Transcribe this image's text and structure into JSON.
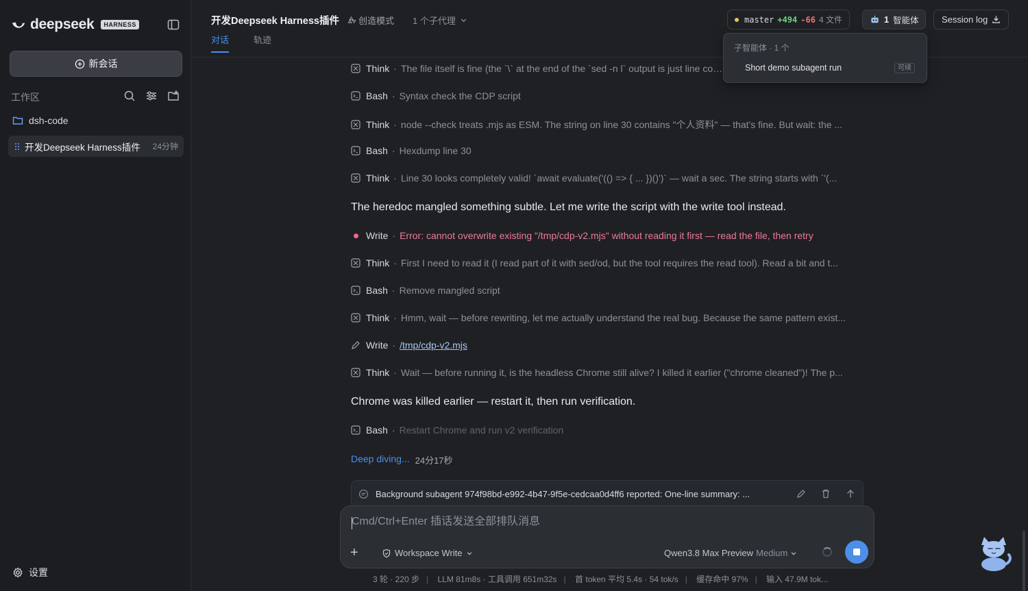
{
  "sidebar": {
    "brand_name": "deepseek",
    "brand_badge": "HARNESS",
    "new_chat_label": "新会话",
    "workspace_label": "工作区",
    "folder_name": "dsh-code",
    "session": {
      "title": "开发Deepseek Harness插件",
      "time": "24分钟"
    },
    "settings_label": "设置"
  },
  "header": {
    "title": "开发Deepseek Harness插件",
    "mode_label": "创造模式",
    "agents_dropdown": "1 个子代理",
    "tabs": [
      {
        "label": "对话"
      },
      {
        "label": "轨迹"
      }
    ],
    "branch": {
      "name": "master",
      "added": "+494",
      "removed": "-66",
      "files": "4 文件"
    },
    "agent_count": "1",
    "agent_label": "智能体",
    "session_log_label": "Session log"
  },
  "popover": {
    "heading": "子智能体 · 1 个",
    "item": "Short demo subagent run",
    "badge": "可续"
  },
  "messages": [
    {
      "kind": "Think",
      "icon": "think-icon",
      "text": "The file itself is fine (the `\\` at the end of the `sed -n l` output is just line continuation)..."
    },
    {
      "kind": "Bash",
      "icon": "terminal-icon",
      "text": "Syntax check the CDP script"
    },
    {
      "kind": "Think",
      "icon": "think-icon",
      "text": "node --check treats .mjs as ESM. The string on line 30 contains \"个人资料\" — that's fine. But wait: the ..."
    },
    {
      "kind": "Bash",
      "icon": "terminal-icon",
      "text": "Hexdump line 30"
    },
    {
      "kind": "Think",
      "icon": "think-icon",
      "text": "Line 30 looks completely valid! `await evaluate('(() => { ... })()')` — wait a sec. The string starts with `'(..."
    },
    {
      "kind": "Write",
      "icon": "error-dot-icon",
      "text": "Error: cannot overwrite existing \"/tmp/cdp-v2.mjs\" without reading it first — read the file, then retry"
    },
    {
      "kind": "Think",
      "icon": "think-icon",
      "text": "First I need to read it (I read part of it with sed/od, but the tool requires the read tool). Read a bit and t..."
    },
    {
      "kind": "Bash",
      "icon": "terminal-icon",
      "text": "Remove mangled script"
    },
    {
      "kind": "Think",
      "icon": "think-icon",
      "text": "Hmm, wait — before rewriting, let me actually understand the real bug. Because the same pattern exist..."
    },
    {
      "kind": "Write",
      "icon": "pencil-icon",
      "text": "/tmp/cdp-v2.mjs"
    },
    {
      "kind": "Think",
      "icon": "think-icon",
      "text": "Wait — before running it, is the headless Chrome still alive? I killed it earlier (\"chrome cleaned\")! The p..."
    },
    {
      "kind": "Bash",
      "icon": "terminal-icon",
      "text": "Restart Chrome and run v2 verification"
    }
  ],
  "paragraphs": [
    "The heredoc mangled something subtle. Let me write the script with the write tool instead.",
    "Chrome was killed earlier — restart it, then run verification."
  ],
  "status": {
    "deep_label": "Deep diving...",
    "elapsed": "24分17秒"
  },
  "background_msg": "Background subagent 974f98bd-e992-4b47-9f5e-cedcaa0d4ff6 reported: One-line summary: ...",
  "composer": {
    "placeholder": "Cmd/Ctrl+Enter 插话发送全部排队消息",
    "permission": "Workspace Write",
    "model": "Qwen3.8 Max Preview",
    "effort": "Medium"
  },
  "stats": [
    "3 轮 · 220 步",
    "LLM 81m8s · 工具调用 651m32s",
    "首 token 平均 5.4s · 54 tok/s",
    "缓存命中 97%",
    "输入 47.9M tok..."
  ],
  "colors": {
    "accent": "#4d8fe8",
    "error": "#ec7a9a",
    "added": "#6fcf83",
    "removed": "#ec7474"
  }
}
